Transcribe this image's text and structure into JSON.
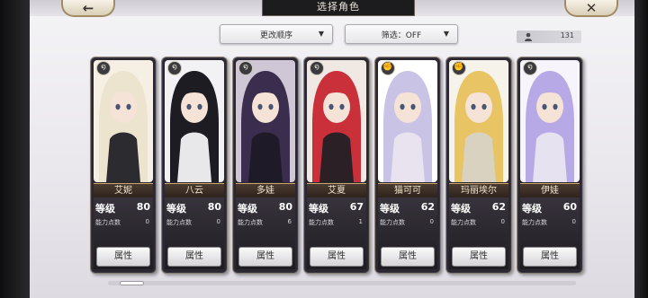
{
  "header": {
    "title": "选择角色",
    "back_icon": "←",
    "close_icon": "✕"
  },
  "toolbar": {
    "sort_label": "更改顺序",
    "filter_label": "筛选：OFF",
    "dropdown_arrow": "▼",
    "character_count": "131"
  },
  "cards": [
    {
      "name": "艾妮",
      "level_label": "等级",
      "level": "80",
      "points_label": "能力点数",
      "points": "0",
      "button": "属性",
      "hair": "#ece4cf",
      "accent": "#f5efe4",
      "outfit": "#2b2b30",
      "element_icon": "wind-swirl-icon"
    },
    {
      "name": "八云",
      "level_label": "等级",
      "level": "80",
      "points_label": "能力点数",
      "points": "0",
      "button": "属性",
      "hair": "#1d1c22",
      "accent": "#f2f2f4",
      "outfit": "#e8e8ea",
      "element_icon": "wind-swirl-icon"
    },
    {
      "name": "多娃",
      "level_label": "等级",
      "level": "80",
      "points_label": "能力点数",
      "points": "6",
      "button": "属性",
      "hair": "#3a2d4e",
      "accent": "#cfc6d6",
      "outfit": "#1f1a27",
      "element_icon": "wind-swirl-icon"
    },
    {
      "name": "艾夏",
      "level_label": "等级",
      "level": "67",
      "points_label": "能力点数",
      "points": "1",
      "button": "属性",
      "hair": "#c9303a",
      "accent": "#f0e8e2",
      "outfit": "#2a2025",
      "element_icon": "wind-swirl-icon"
    },
    {
      "name": "猫可可",
      "level_label": "等级",
      "level": "62",
      "points_label": "能力点数",
      "points": "0",
      "button": "属性",
      "hair": "#c9c3e6",
      "accent": "#ffffff",
      "outfit": "#e8e3ef",
      "element_icon": "fist-icon"
    },
    {
      "name": "玛丽埃尔",
      "level_label": "等级",
      "level": "62",
      "points_label": "能力点数",
      "points": "0",
      "button": "属性",
      "hair": "#e8c464",
      "accent": "#f6f3ea",
      "outfit": "#d9d2c0",
      "element_icon": "fist-icon"
    },
    {
      "name": "伊娃",
      "level_label": "等级",
      "level": "60",
      "points_label": "能力点数",
      "points": "0",
      "button": "属性",
      "hair": "#b7a9e6",
      "accent": "#f7f5fb",
      "outfit": "#e6e2ef",
      "element_icon": "wind-swirl-icon"
    }
  ]
}
